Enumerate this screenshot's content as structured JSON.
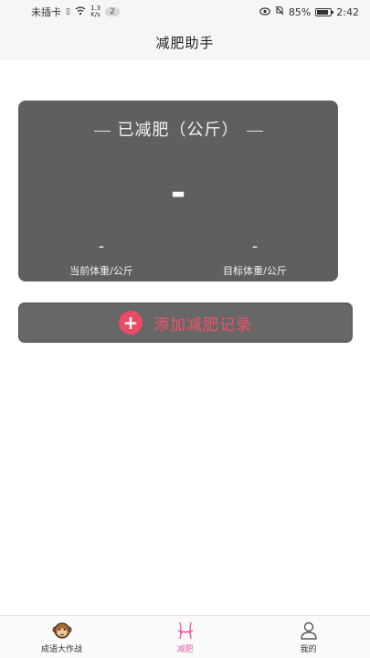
{
  "status_bar": {
    "carrier": "未插卡",
    "net_speed_value": "1.3",
    "net_speed_unit": "K/s",
    "notification_count": "2",
    "battery_text": "85%",
    "battery_level": 0.85,
    "time": "2:42"
  },
  "nav": {
    "title": "减肥助手"
  },
  "card": {
    "title": "已减肥（公斤）",
    "lost_value": "-",
    "current_weight_value": "-",
    "current_weight_label": "当前体重/公斤",
    "target_weight_value": "-",
    "target_weight_label": "目标体重/公斤",
    "background_color": "#5f5f5f"
  },
  "add_record": {
    "label": "添加减肥记录",
    "icon_glyph": "+",
    "accent_color": "#f0506a"
  },
  "tabs": [
    {
      "label": "成语大作战",
      "icon": "monkey-face-icon",
      "active": false
    },
    {
      "label": "减肥",
      "icon": "waist-measure-icon",
      "active": true
    },
    {
      "label": "我的",
      "icon": "user-profile-icon",
      "active": false
    }
  ]
}
